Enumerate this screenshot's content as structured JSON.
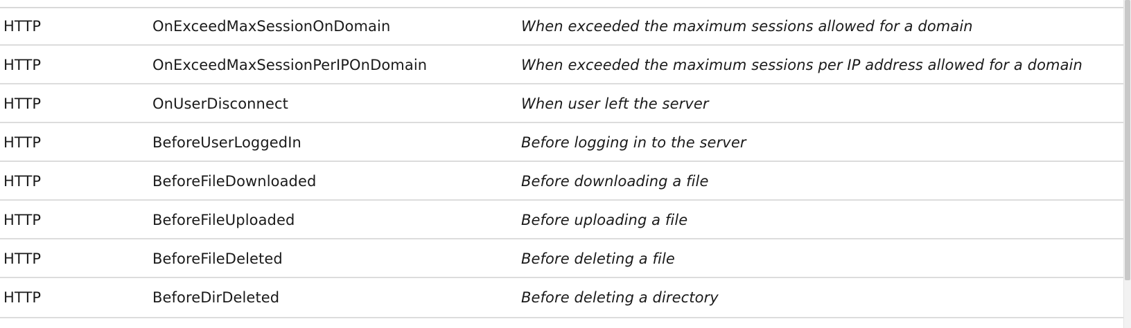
{
  "events_table": {
    "rows": [
      {
        "type": "HTTP",
        "event": "OnExceedMaxSessionOnDomain",
        "description": "When exceeded the maximum sessions allowed for a domain"
      },
      {
        "type": "HTTP",
        "event": "OnExceedMaxSessionPerIPOnDomain",
        "description": "When exceeded the maximum sessions per IP address allowed for a domain"
      },
      {
        "type": "HTTP",
        "event": "OnUserDisconnect",
        "description": "When user left the server"
      },
      {
        "type": "HTTP",
        "event": "BeforeUserLoggedIn",
        "description": "Before logging in to the server"
      },
      {
        "type": "HTTP",
        "event": "BeforeFileDownloaded",
        "description": "Before downloading a file"
      },
      {
        "type": "HTTP",
        "event": "BeforeFileUploaded",
        "description": "Before uploading a file"
      },
      {
        "type": "HTTP",
        "event": "BeforeFileDeleted",
        "description": "Before deleting a file"
      },
      {
        "type": "HTTP",
        "event": "BeforeDirDeleted",
        "description": "Before deleting a directory"
      }
    ]
  }
}
